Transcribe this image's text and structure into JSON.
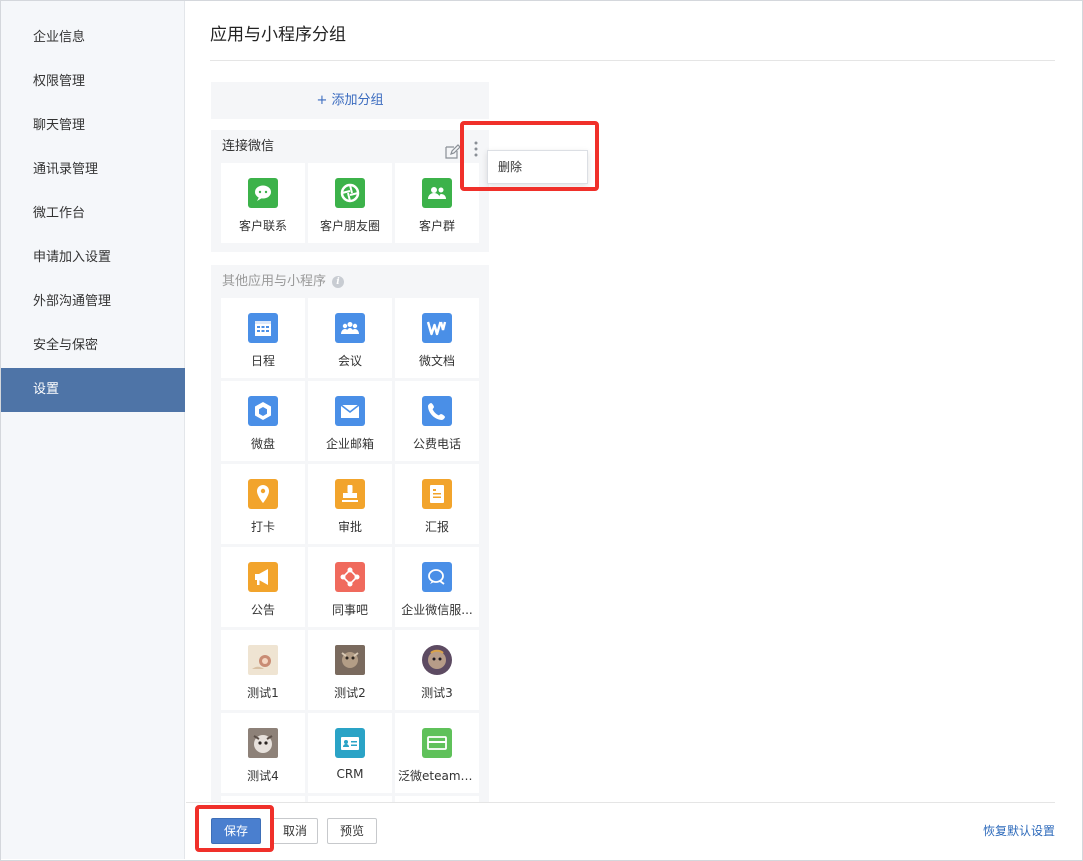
{
  "sidebar": {
    "items": [
      {
        "label": "企业信息"
      },
      {
        "label": "权限管理"
      },
      {
        "label": "聊天管理"
      },
      {
        "label": "通讯录管理"
      },
      {
        "label": "微工作台"
      },
      {
        "label": "申请加入设置"
      },
      {
        "label": "外部沟通管理"
      },
      {
        "label": "安全与保密"
      },
      {
        "label": "设置"
      }
    ],
    "active": "设置"
  },
  "main": {
    "title": "应用与小程序分组",
    "add_group_label": "+ 添加分组",
    "groups": [
      {
        "name": "连接微信",
        "apps": [
          {
            "label": "客户联系",
            "icon": "wechat-chat-icon",
            "color": "#3cb24a"
          },
          {
            "label": "客户朋友圈",
            "icon": "aperture-icon",
            "color": "#3cb24a"
          },
          {
            "label": "客户群",
            "icon": "people-group-icon",
            "color": "#3cb24a"
          }
        ]
      },
      {
        "name": "其他应用与小程序",
        "apps": [
          {
            "label": "日程",
            "icon": "calendar-icon",
            "color": "#4a8fe7"
          },
          {
            "label": "会议",
            "icon": "meeting-icon",
            "color": "#4a8fe7"
          },
          {
            "label": "微文档",
            "icon": "document-w-icon",
            "color": "#4a8fe7"
          },
          {
            "label": "微盘",
            "icon": "drive-icon",
            "color": "#4a8fe7"
          },
          {
            "label": "企业邮箱",
            "icon": "mail-icon",
            "color": "#4a8fe7"
          },
          {
            "label": "公费电话",
            "icon": "phone-icon",
            "color": "#4a8fe7"
          },
          {
            "label": "打卡",
            "icon": "location-pin-icon",
            "color": "#f2a42c"
          },
          {
            "label": "审批",
            "icon": "stamp-icon",
            "color": "#f2a42c"
          },
          {
            "label": "汇报",
            "icon": "report-icon",
            "color": "#f2a42c"
          },
          {
            "label": "公告",
            "icon": "megaphone-icon",
            "color": "#f2a42c"
          },
          {
            "label": "同事吧",
            "icon": "network-icon",
            "color": "#f06a5d"
          },
          {
            "label": "企业微信服...",
            "icon": "service-chat-icon",
            "color": "#4a8fe7"
          },
          {
            "label": "测试1",
            "icon": "photo-thumbnail-icon",
            "color": "#e9d9c4"
          },
          {
            "label": "测试2",
            "icon": "photo-thumbnail-icon",
            "color": "#8d7866"
          },
          {
            "label": "测试3",
            "icon": "photo-thumbnail-icon",
            "color": "#6e5a74"
          },
          {
            "label": "测试4",
            "icon": "photo-thumbnail-icon",
            "color": "#9c8f86"
          },
          {
            "label": "CRM",
            "icon": "id-card-icon",
            "color": "#2aa3c6"
          },
          {
            "label": "泛微eteams...",
            "icon": "card-icon",
            "color": "#5fc15a"
          }
        ]
      }
    ]
  },
  "popup": {
    "delete_label": "删除"
  },
  "footer": {
    "save_label": "保存",
    "cancel_label": "取消",
    "preview_label": "预览",
    "restore_label": "恢复默认设置"
  },
  "colors": {
    "sidebar_active": "#4e74a7",
    "primary_button": "#4a7fcf",
    "highlight": "#f0302a",
    "link": "#2d6abb"
  }
}
